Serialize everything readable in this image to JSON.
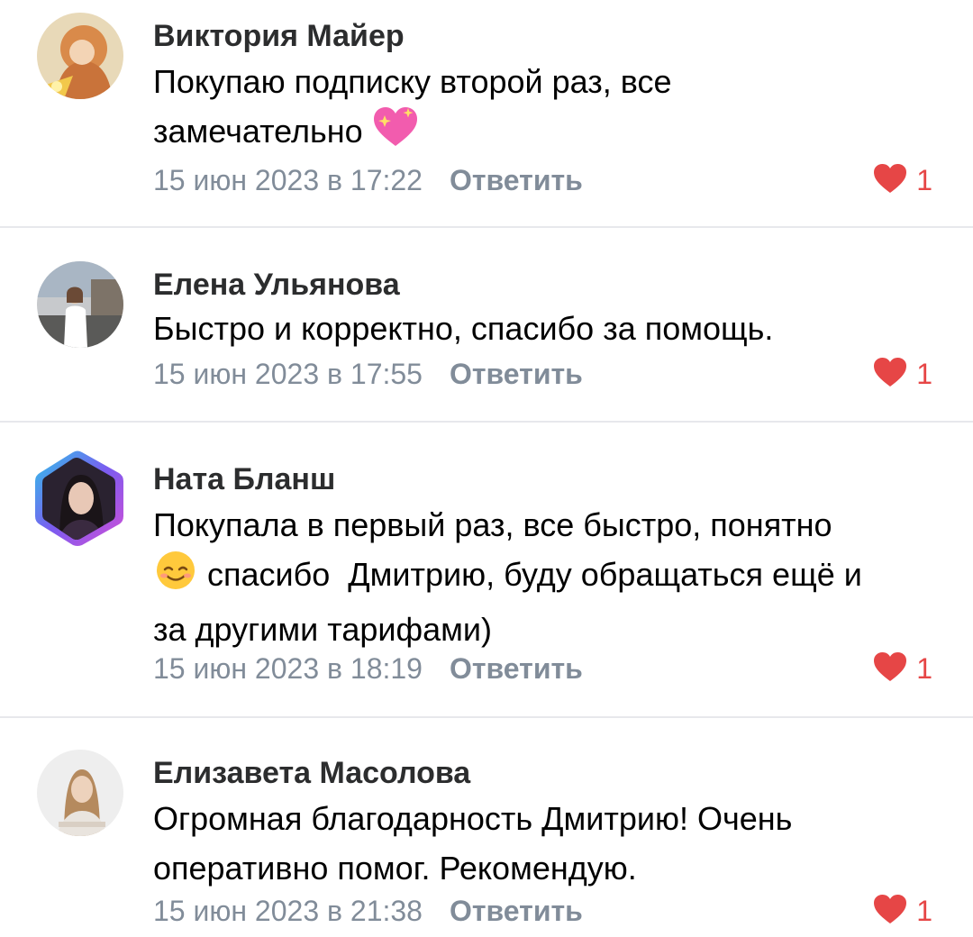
{
  "colors": {
    "like": "#e64646",
    "meta": "#818c99",
    "author": "#2c2d2e",
    "divider": "#e7e8ec"
  },
  "comments": [
    {
      "author": "Виктория Майер",
      "text_parts": [
        "Покупаю подписку второй раз, все",
        "замечательно "
      ],
      "emoji": "sparkling-heart-icon",
      "date": "15 июн 2023 в 17:22",
      "reply_label": "Ответить",
      "likes": "1"
    },
    {
      "author": "Елена Ульянова",
      "text": "Быстро и корректно, спасибо за помощь.",
      "date": "15 июн 2023 в 17:55",
      "reply_label": "Ответить",
      "likes": "1"
    },
    {
      "author": "Ната Бланш",
      "text_parts": [
        "Покупала в первый раз, все быстро, понятно",
        " спасибо  Дмитрию, буду обращаться ещё и",
        "за другими тарифами)"
      ],
      "emoji": "smiling-face-icon",
      "date": "15 июн 2023 в 18:19",
      "reply_label": "Ответить",
      "likes": "1"
    },
    {
      "author": "Елизавета Масолова",
      "text_parts": [
        "Огромная благодарность Дмитрию! Очень",
        "оперативно помог. Рекомендую."
      ],
      "date": "15 июн 2023 в 21:38",
      "reply_label": "Ответить",
      "likes": "1"
    }
  ]
}
